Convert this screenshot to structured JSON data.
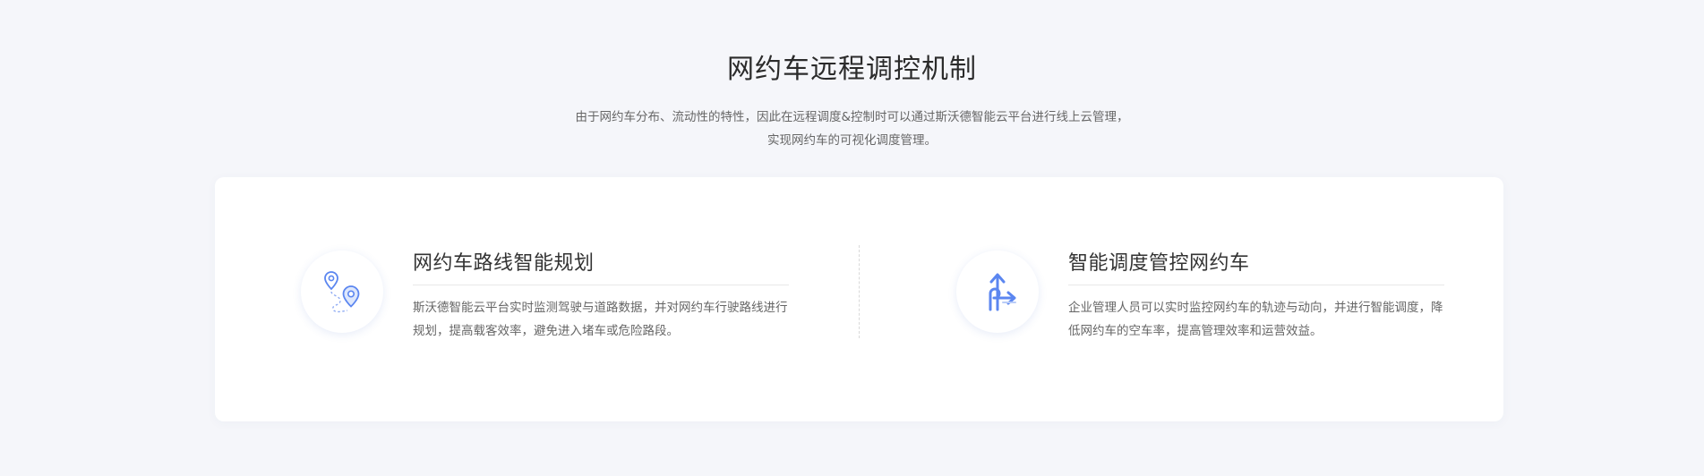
{
  "section": {
    "title": "网约车远程调控机制",
    "desc_line1": "由于网约车分布、流动性的特性，因此在远程调度&控制时可以通过斯沃德智能云平台进行线上云管理，",
    "desc_line2": "实现网约车的可视化调度管理。"
  },
  "features": [
    {
      "icon": "route-pins-icon",
      "title": "网约车路线智能规划",
      "text": "斯沃德智能云平台实时监测驾驶与道路数据，并对网约车行驶路线进行规划，提高载客效率，避免进入堵车或危险路段。"
    },
    {
      "icon": "dispatch-arrows-icon",
      "title": "智能调度管控网约车",
      "text": "企业管理人员可以实时监控网约车的轨迹与动向，并进行智能调度，降低网约车的空车率，提高管理效率和运营效益。"
    }
  ],
  "colors": {
    "background": "#f5f6fa",
    "card": "#ffffff",
    "icon_accent": "#5b86f0",
    "icon_light": "#b9ccf7"
  }
}
